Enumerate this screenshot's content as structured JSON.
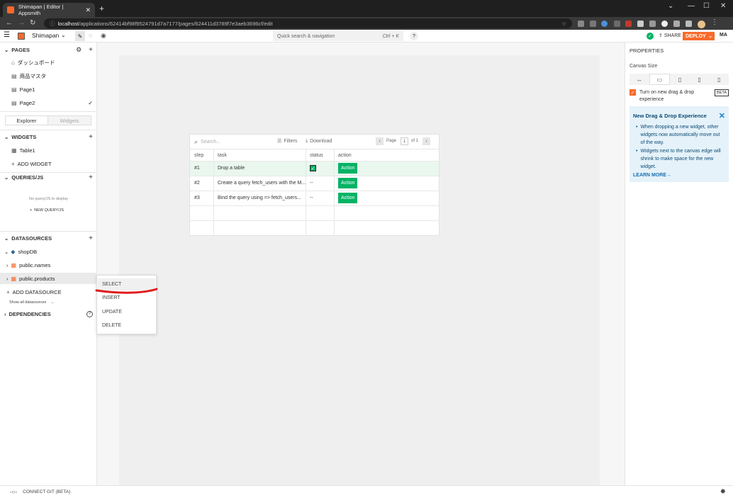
{
  "browser": {
    "tab_title": "Shimapan | Editor | Appsmith",
    "url_host": "localhost",
    "url_path": "/applications/62414bf98f9524791d7a7177/pages/624411d3789f7e3aeb3696cf/edit",
    "new_tab": "+"
  },
  "header": {
    "app_name": "Shimapan",
    "search_placeholder": "Quick search & navigation",
    "search_shortcut": "Ctrl + K",
    "help": "?",
    "share": "SHARE",
    "deploy": "DEPLOY",
    "avatar": "MA"
  },
  "sidebar": {
    "pages_title": "PAGES",
    "pages": [
      "ダッシュボード",
      "商品マスタ",
      "Page1",
      "Page2"
    ],
    "tab_explorer": "Explorer",
    "tab_widgets": "Widgets",
    "widgets_title": "WIDGETS",
    "widgets": [
      "Table1"
    ],
    "add_widget": "ADD WIDGET",
    "queries_title": "QUERIES/JS",
    "no_query": "No query/JS to display",
    "new_query": "NEW QUERY/JS",
    "datasources_title": "DATASOURCES",
    "datasource": "shopDB",
    "tables": [
      "public.names",
      "public.products"
    ],
    "add_datasource": "ADD DATASOURCE",
    "show_all": "Show all datasources",
    "dependencies": "DEPENDENCIES"
  },
  "context_menu": [
    "SELECT",
    "INSERT",
    "UPDATE",
    "DELETE"
  ],
  "table": {
    "search_placeholder": "Search...",
    "filters": "Filters",
    "download": "Download",
    "page_label": "Page",
    "page_value": "1",
    "page_of": "of 1",
    "columns": [
      "step",
      "task",
      "status",
      "action"
    ],
    "rows": [
      {
        "step": "#1",
        "task": "Drop a table",
        "status": "✓",
        "action": "Action"
      },
      {
        "step": "#2",
        "task": "Create a query fetch_users with the M...",
        "status": "--",
        "action": "Action"
      },
      {
        "step": "#3",
        "task": "Bind the query using => fetch_users...",
        "status": "--",
        "action": "Action"
      }
    ]
  },
  "properties": {
    "title": "PROPERTIES",
    "canvas_size": "Canvas Size",
    "dnd_label": "Turn on new drag & drop experience",
    "beta": "BETA",
    "info_title": "New Drag & Drop Experience",
    "info_bullets": [
      "When dropping a new widget, other widgets now automatically move out of the way.",
      "Widgets next to the canvas edge will shrink to make space for the new widget."
    ],
    "learn_more": "LEARN MORE→"
  },
  "footer": {
    "connect_git": "CONNECT GIT (BETA)"
  },
  "colors": {
    "brand": "#f86a2b",
    "action_green": "#03b365",
    "info_bg": "#e5f2fa"
  }
}
